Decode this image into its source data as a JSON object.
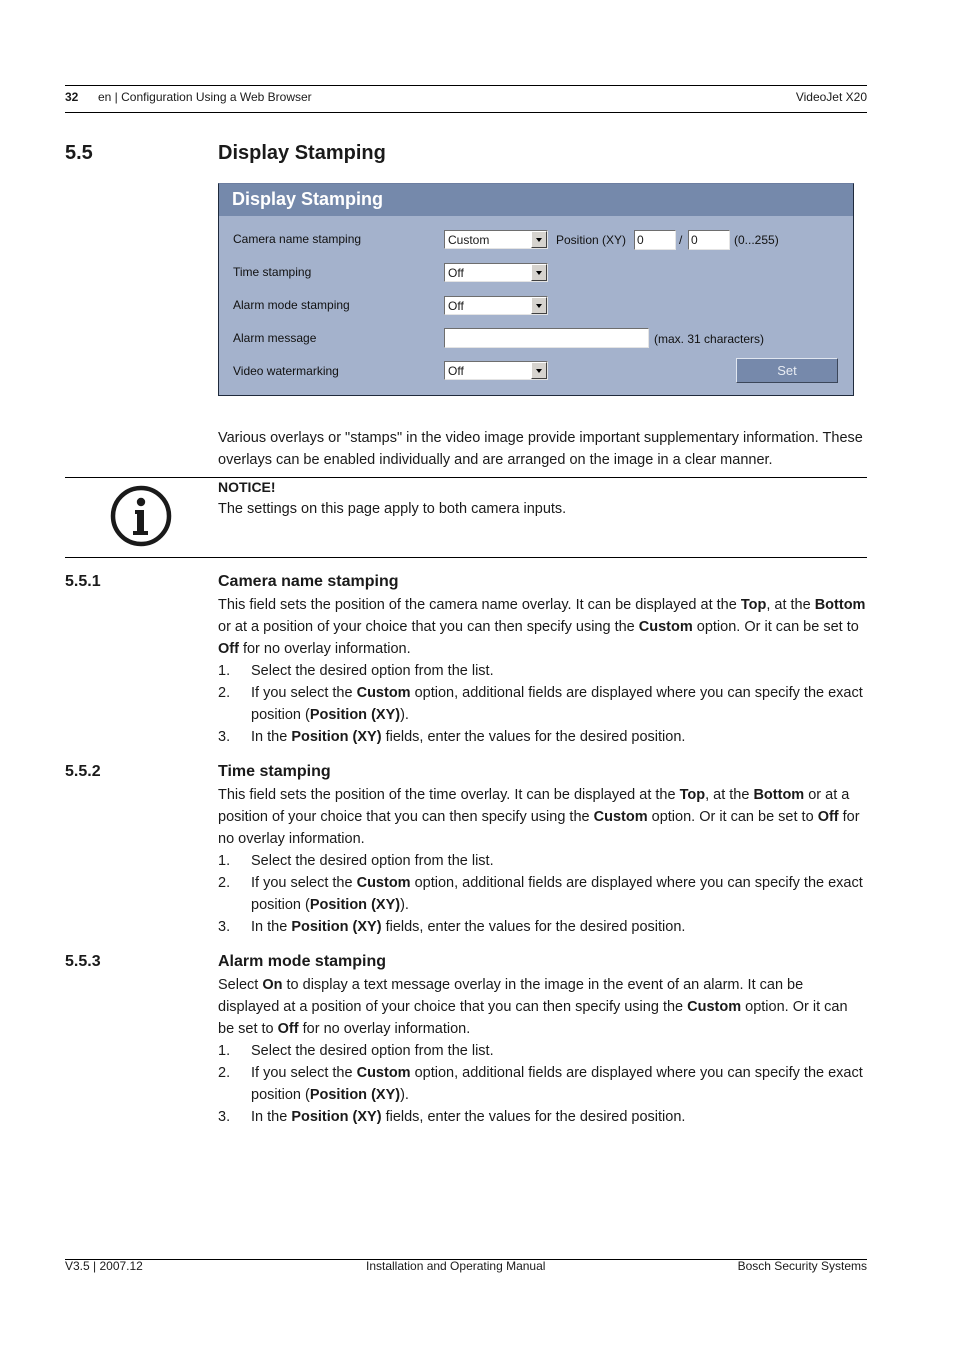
{
  "header": {
    "page_number": "32",
    "section_path": "en | Configuration Using a Web Browser",
    "product": "VideoJet X20"
  },
  "section": {
    "number": "5.5",
    "title": "Display Stamping"
  },
  "panel": {
    "title": "Display Stamping",
    "rows": [
      {
        "label": "Camera name stamping",
        "value": "Custom"
      },
      {
        "label": "Time stamping",
        "value": "Off"
      },
      {
        "label": "Alarm mode stamping",
        "value": "Off"
      },
      {
        "label": "Alarm message",
        "value": ""
      },
      {
        "label": "Video watermarking",
        "value": "Off"
      }
    ],
    "position_label": "Position (XY)",
    "position_x": "0",
    "position_separator": "/",
    "position_y": "0",
    "position_range": "(0...255)",
    "alarm_message_hint": "(max. 31 characters)",
    "set_label": "Set"
  },
  "intro": {
    "text": "Various overlays or \"stamps\" in the video image provide important supplementary information. These overlays can be enabled individually and are arranged on the image in a clear manner."
  },
  "notice": {
    "icon": "info-icon",
    "title": "NOTICE!",
    "text": "The settings on this page apply to both camera inputs."
  },
  "subsections": [
    {
      "number": "5.5.1",
      "title": "Camera name stamping",
      "paragraph": [
        {
          "t": "This field sets the position of the camera name overlay. It can be displayed at the "
        },
        {
          "b": "Top"
        },
        {
          "t": ", at the "
        },
        {
          "b": "Bottom"
        },
        {
          "t": " or at a position of your choice that you can then specify using the "
        },
        {
          "b": "Custom"
        },
        {
          "t": " option. Or it can be set to "
        },
        {
          "b": "Off"
        },
        {
          "t": " for no overlay information."
        }
      ],
      "steps": [
        {
          "n": "1.",
          "parts": [
            {
              "t": "Select the desired option from the list."
            }
          ]
        },
        {
          "n": "2.",
          "parts": [
            {
              "t": "If you select the "
            },
            {
              "b": "Custom"
            },
            {
              "t": " option, additional fields are displayed where you can specify the exact position ("
            },
            {
              "b": "Position (XY)"
            },
            {
              "t": ")."
            }
          ]
        },
        {
          "n": "3.",
          "parts": [
            {
              "t": "In the "
            },
            {
              "b": "Position (XY)"
            },
            {
              "t": " fields, enter the values for the desired position."
            }
          ]
        }
      ]
    },
    {
      "number": "5.5.2",
      "title": "Time stamping",
      "paragraph": [
        {
          "t": "This field sets the position of the time overlay. It can be displayed at the "
        },
        {
          "b": "Top"
        },
        {
          "t": ", at the "
        },
        {
          "b": "Bottom"
        },
        {
          "t": " or at a position of your choice that you can then specify using the "
        },
        {
          "b": "Custom"
        },
        {
          "t": " option. Or it can be set to "
        },
        {
          "b": "Off"
        },
        {
          "t": " for no overlay information."
        }
      ],
      "steps": [
        {
          "n": "1.",
          "parts": [
            {
              "t": "Select the desired option from the list."
            }
          ]
        },
        {
          "n": "2.",
          "parts": [
            {
              "t": "If you select the "
            },
            {
              "b": "Custom"
            },
            {
              "t": " option, additional fields are displayed where you can specify the exact position ("
            },
            {
              "b": "Position (XY)"
            },
            {
              "t": ")."
            }
          ]
        },
        {
          "n": "3.",
          "parts": [
            {
              "t": "In the "
            },
            {
              "b": "Position (XY)"
            },
            {
              "t": " fields, enter the values for the desired position."
            }
          ]
        }
      ]
    },
    {
      "number": "5.5.3",
      "title": "Alarm mode stamping",
      "paragraph": [
        {
          "t": "Select "
        },
        {
          "b": "On"
        },
        {
          "t": " to display a text message overlay in the image in the event of an alarm. It can be displayed at a position of your choice that you can then specify using the "
        },
        {
          "b": "Custom"
        },
        {
          "t": " option. Or it can be set to "
        },
        {
          "b": "Off"
        },
        {
          "t": " for no overlay information."
        }
      ],
      "steps": [
        {
          "n": "1.",
          "parts": [
            {
              "t": "Select the desired option from the list."
            }
          ]
        },
        {
          "n": "2.",
          "parts": [
            {
              "t": "If you select the "
            },
            {
              "b": "Custom"
            },
            {
              "t": " option, additional fields are displayed where you can specify the exact position ("
            },
            {
              "b": "Position (XY)"
            },
            {
              "t": ")."
            }
          ]
        },
        {
          "n": "3.",
          "parts": [
            {
              "t": "In the "
            },
            {
              "b": "Position (XY)"
            },
            {
              "t": " fields, enter the values for the desired position."
            }
          ]
        }
      ]
    }
  ],
  "footer": {
    "version": "V3.5 | 2007.12",
    "manual": "Installation and Operating Manual",
    "company": "Bosch Security Systems"
  }
}
